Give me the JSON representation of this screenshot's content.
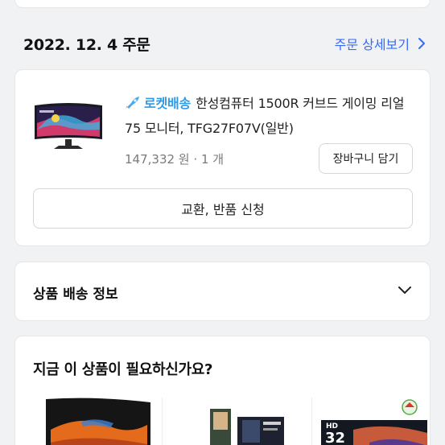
{
  "order": {
    "date": "2022. 12. 4 주문",
    "detail_link": "주문 상세보기"
  },
  "product": {
    "badge": "로켓배송",
    "title": "한성컴퓨터 1500R 커브드 게이밍 리얼 75 모니터, TFG27F07V(일반)",
    "price": "147,332 원",
    "separator": "·",
    "quantity": "1 개",
    "cart_button": "장바구니 담기",
    "return_button": "교환, 반품 신청"
  },
  "shipping": {
    "title": "상품 배송 정보"
  },
  "recommend": {
    "title": "지금 이 상품이 필요하신가요?",
    "item3_badge": "HD",
    "item3_size": "32"
  }
}
